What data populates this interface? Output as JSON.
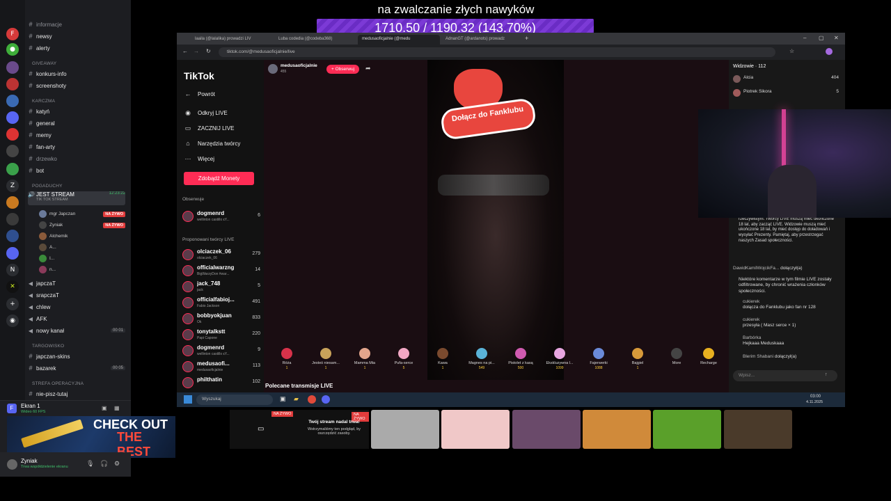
{
  "overlay": {
    "caption": "na zwalczanie złych nawyków",
    "progress_text": "1710.50 / 1190.32 (143.70%)"
  },
  "discord": {
    "channels_top": [
      {
        "name": "informacje"
      },
      {
        "name": "newsy"
      },
      {
        "name": "alerty"
      }
    ],
    "categories": [
      "GIVEAWAY",
      "KARCZMA",
      "POGADUCHY",
      "TARGOWISKO",
      "STREFA OPERACYJNA"
    ],
    "giveaway": [
      {
        "name": "konkurs-info"
      },
      {
        "name": "screenshoty"
      }
    ],
    "karczma": [
      {
        "name": "katyń"
      },
      {
        "name": "general"
      },
      {
        "name": "memy"
      },
      {
        "name": "fan-arty"
      },
      {
        "name": "drzewko"
      },
      {
        "name": "bot"
      }
    ],
    "jest_stream": {
      "name": "JEST STREAM",
      "sub": "TIK TOK STREAM",
      "time": "12:23:22"
    },
    "voice_users": [
      {
        "name": "mgr Japczan",
        "badge": "NA ŻYWO"
      },
      {
        "name": "Zyniak",
        "badge": "NA ŻYWO"
      },
      {
        "name": "Alchemik",
        "badge": ""
      },
      {
        "name": "A...",
        "badge": ""
      },
      {
        "name": "I...",
        "badge": ""
      },
      {
        "name": "n...",
        "badge": ""
      }
    ],
    "voice_channels": [
      {
        "name": "japczaT",
        "count": ""
      },
      {
        "name": "srapczaT",
        "count": ""
      },
      {
        "name": "chlew",
        "count": ""
      },
      {
        "name": "AFK",
        "count": ""
      },
      {
        "name": "nowy kanał",
        "count": "00 01"
      }
    ],
    "targowisko": [
      {
        "name": "japczan-skins",
        "count": ""
      },
      {
        "name": "bazarek",
        "count": "00 05"
      }
    ],
    "strefa": [
      {
        "name": "nie-pisz-tutaj"
      }
    ],
    "voice_panel": {
      "title": "Ekran 1",
      "sub": "Wideo 60 FPS"
    },
    "ad_text": [
      "CHECK OUT",
      "THE BEST"
    ],
    "user": {
      "name": "Zyniak",
      "status": "Trwa współdzielenie ekranu"
    }
  },
  "browser": {
    "tabs": [
      "laaila (@lalalika) prowadzi LIV",
      "Luba codedia (@codeba368)",
      "medusaoficjalnie (@medu",
      "AdnanGT (@ardanots) prowadz"
    ],
    "url": "tiktok.com/@medusaoficjalnie/live"
  },
  "tiktok": {
    "logo": "TikTok",
    "nav": [
      {
        "label": "Powrót",
        "icon": "back-icon"
      },
      {
        "label": "Odkryj LIVE",
        "icon": "live-icon"
      },
      {
        "label": "ZACZNIJ LIVE",
        "icon": "camera-icon"
      },
      {
        "label": "Narzędzia twórcy",
        "icon": "home-icon"
      },
      {
        "label": "Więcej",
        "icon": "more-icon"
      }
    ],
    "coins_button": "Zdobądź Monety",
    "following_label": "Obserwuje",
    "following": [
      {
        "name": "dogmenrd",
        "sub": "wellinton castillo ɛY...",
        "n": "6"
      }
    ],
    "suggested_label": "Proponowani twórcy LIVE",
    "suggested": [
      {
        "name": "olciaczek_06",
        "sub": "olciaczek_06",
        "n": "279"
      },
      {
        "name": "officialwarzng",
        "sub": "BigWarzyDon #war...",
        "n": "14"
      },
      {
        "name": "jack_748",
        "sub": "jack",
        "n": "5"
      },
      {
        "name": "officialfabioj...",
        "sub": "Fabio Jackson",
        "n": "491"
      },
      {
        "name": "bobbyokjuan",
        "sub": "Ok",
        "n": "833"
      },
      {
        "name": "tonytalkstt",
        "sub": "Papi Capone",
        "n": "220"
      },
      {
        "name": "dogmenrd",
        "sub": "wellinton castillo ɛY...",
        "n": "9"
      },
      {
        "name": "medusaofi...",
        "sub": "medusaoficjalnie",
        "n": "113"
      },
      {
        "name": "philthatin",
        "sub": "",
        "n": "102"
      }
    ],
    "streamer": {
      "name": "medusaoficjalnie",
      "viewers": "455",
      "follow": "+ Obserwuj"
    },
    "fanclub": "Dołącz do Fanklubu",
    "recommended": "Polecane transmisje LIVE",
    "gifts": [
      {
        "name": "Róża",
        "price": "1",
        "color": "#d8324a"
      },
      {
        "name": "Jesteś niesam...",
        "price": "1",
        "color": "#c9a35a"
      },
      {
        "name": "Mamma Mia",
        "price": "1",
        "color": "#e3a58c"
      },
      {
        "name": "Pufa-serce",
        "price": "5",
        "color": "#f2a7c4"
      },
      {
        "name": "Kawa",
        "price": "1",
        "color": "#7a4a2e"
      },
      {
        "name": "Magnes na pi...",
        "price": "549",
        "color": "#5ab3d8"
      },
      {
        "name": "Pistolet z kasą",
        "price": "500",
        "color": "#d05ab0"
      },
      {
        "name": "Ekskluzywna l...",
        "price": "1099",
        "color": "#e8a6e0"
      },
      {
        "name": "Fajerwerki",
        "price": "1088",
        "color": "#6a8ad8"
      },
      {
        "name": "Bajgiel",
        "price": "1",
        "color": "#d89a3a"
      },
      {
        "name": "More",
        "price": "",
        "color": "#444"
      },
      {
        "name": "Recharge",
        "price": "",
        "color": "#e8b020"
      }
    ],
    "chat": {
      "header": "Widzowie · 112",
      "viewers": [
        {
          "name": "Alcia",
          "n": "404"
        },
        {
          "name": "Piotrek Sikora",
          "n": "5"
        }
      ],
      "notice": "wchodząc w interakcje z innymi w czasie rzeczywistym. Twórcy LIVE muszą mieć ukończone 18 lat, aby zacząć LIVE. Widzowie muszą mieć ukończone 18 lat, by mieć dostęp do doładowań i wysyłać Prezenty. Pamiętaj, aby przestrzegać naszych Zasad społeczności.",
      "messages": [
        {
          "user": "DawidKamilWojcikFa...",
          "text": "dołączył(a)"
        },
        {
          "user": "",
          "text": "Niektóre komentarze w tym filmie LIVE zostały odfiltrowane, by chronić wrażenia członków społeczności."
        },
        {
          "user": "cukierek",
          "text": "dołącza do Fanklubu jako fan nr 128"
        },
        {
          "user": "cukierek",
          "text": "przesyła ( Masz serce × 1)"
        },
        {
          "user": "Barbórka",
          "text": "Hejkaaa Meduskaaa"
        },
        {
          "user": "Blerim Shabani",
          "text": "dołączył(a)"
        }
      ],
      "input_placeholder": "Wpisz..."
    }
  },
  "taskbar": {
    "search": "Wyszukaj",
    "time": "03:00",
    "date": "4.11.2025"
  },
  "bottom": {
    "live_badge": "NA ŻYWO",
    "msg_title": "Twój stream nadal trwa!",
    "msg_body": "Wstrzymaliśmy ten podgląd, by oszczędzić zasoby."
  }
}
